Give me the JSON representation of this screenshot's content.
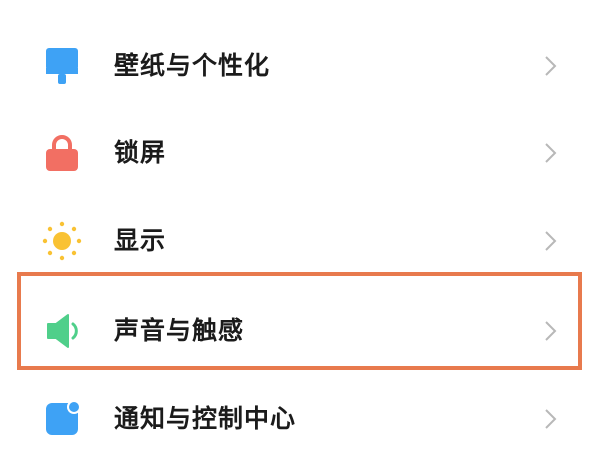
{
  "settings": {
    "items": [
      {
        "label": "壁纸与个性化",
        "icon": "wallpaper-brush-icon",
        "icon_color": "#3ea2f5"
      },
      {
        "label": "锁屏",
        "icon": "lock-icon",
        "icon_color": "#f26f63"
      },
      {
        "label": "显示",
        "icon": "sun-icon",
        "icon_color": "#f9c233"
      },
      {
        "label": "声音与触感",
        "icon": "speaker-icon",
        "icon_color": "#4fcf8a"
      },
      {
        "label": "通知与控制中心",
        "icon": "notification-icon",
        "icon_color": "#3ea2f5"
      }
    ]
  },
  "colors": {
    "highlight_border": "#e87a4d",
    "text": "#1b1b1b",
    "chevron": "#b8b8b8"
  }
}
